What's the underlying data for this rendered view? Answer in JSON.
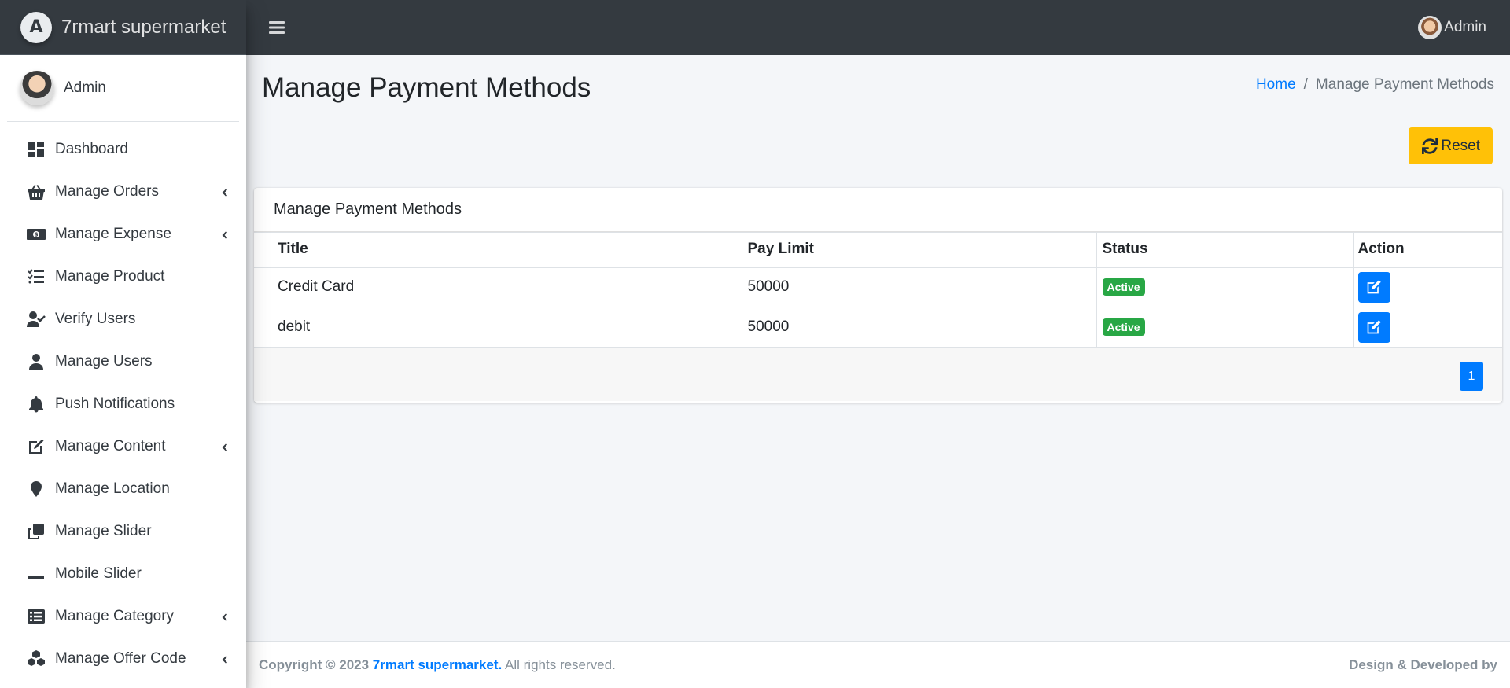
{
  "brand": {
    "logo_letter": "A",
    "name": "7rmart supermarket"
  },
  "sidebar": {
    "user_name": "Admin",
    "items": [
      {
        "label": "Dashboard",
        "icon": "dashboard-icon",
        "has_submenu": false
      },
      {
        "label": "Manage Orders",
        "icon": "basket-icon",
        "has_submenu": true
      },
      {
        "label": "Manage Expense",
        "icon": "money-bill-icon",
        "has_submenu": true
      },
      {
        "label": "Manage Product",
        "icon": "tasks-icon",
        "has_submenu": false
      },
      {
        "label": "Verify Users",
        "icon": "user-check-icon",
        "has_submenu": false
      },
      {
        "label": "Manage Users",
        "icon": "user-icon",
        "has_submenu": false
      },
      {
        "label": "Push Notifications",
        "icon": "bell-icon",
        "has_submenu": false
      },
      {
        "label": "Manage Content",
        "icon": "edit-icon",
        "has_submenu": true
      },
      {
        "label": "Manage Location",
        "icon": "map-marker-icon",
        "has_submenu": false
      },
      {
        "label": "Manage Slider",
        "icon": "clone-icon",
        "has_submenu": false
      },
      {
        "label": "Mobile Slider",
        "icon": "minus-icon",
        "has_submenu": false
      },
      {
        "label": "Manage Category",
        "icon": "list-alt-icon",
        "has_submenu": true
      },
      {
        "label": "Manage Offer Code",
        "icon": "cubes-icon",
        "has_submenu": true
      }
    ]
  },
  "topbar": {
    "user_name": "Admin"
  },
  "page": {
    "title": "Manage Payment Methods",
    "breadcrumb": {
      "home": "Home",
      "separator": "/",
      "current": "Manage Payment Methods"
    },
    "reset_label": "Reset"
  },
  "card": {
    "title": "Manage Payment Methods",
    "columns": [
      "Title",
      "Pay Limit",
      "Status",
      "Action"
    ],
    "rows": [
      {
        "title": "Credit Card",
        "pay_limit": "50000",
        "status": "Active"
      },
      {
        "title": "debit",
        "pay_limit": "50000",
        "status": "Active"
      }
    ],
    "pagination": {
      "current_page": "1"
    }
  },
  "footer": {
    "copyright_prefix": "Copyright © 2023",
    "company": "7rmart supermarket.",
    "rights": "All rights reserved.",
    "credit": "Design & Developed by"
  },
  "colors": {
    "topbar": "#343a40",
    "primary": "#007bff",
    "warning": "#ffc107",
    "success": "#28a745",
    "content_bg": "#f4f6f9"
  }
}
